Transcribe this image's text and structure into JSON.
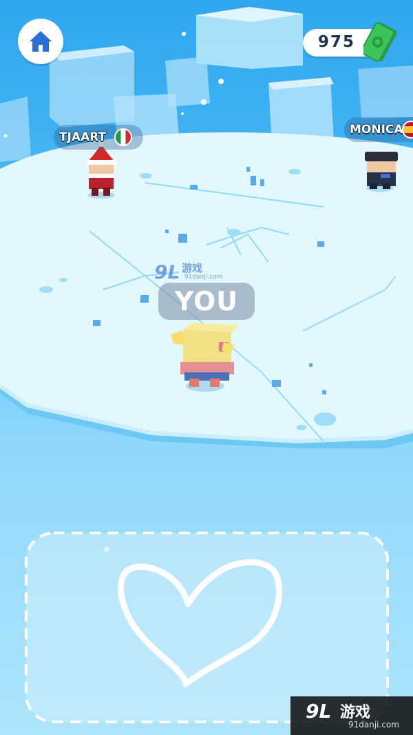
{
  "hud": {
    "home_icon": "home-icon",
    "money": "975",
    "money_icon": "cash-bills-icon"
  },
  "players": [
    {
      "name": "TJAART",
      "flag": "italy-flag-icon"
    },
    {
      "name": "MONICA",
      "flag": "spain-flag-icon"
    },
    {
      "name": "YOU"
    }
  ],
  "drawing_pad": {
    "shape": "heart",
    "border_style": "dashed"
  },
  "watermark": {
    "top_text": "游戏",
    "top_url": "91danji.com",
    "bottom_logo": "9L",
    "bottom_text": "游戏",
    "bottom_url": "91danji.com"
  },
  "colors": {
    "sky": "#2fa6ef",
    "ice": "#dff5fd",
    "accent_home": "#2a6fd6",
    "money_green": "#3cc35a"
  }
}
